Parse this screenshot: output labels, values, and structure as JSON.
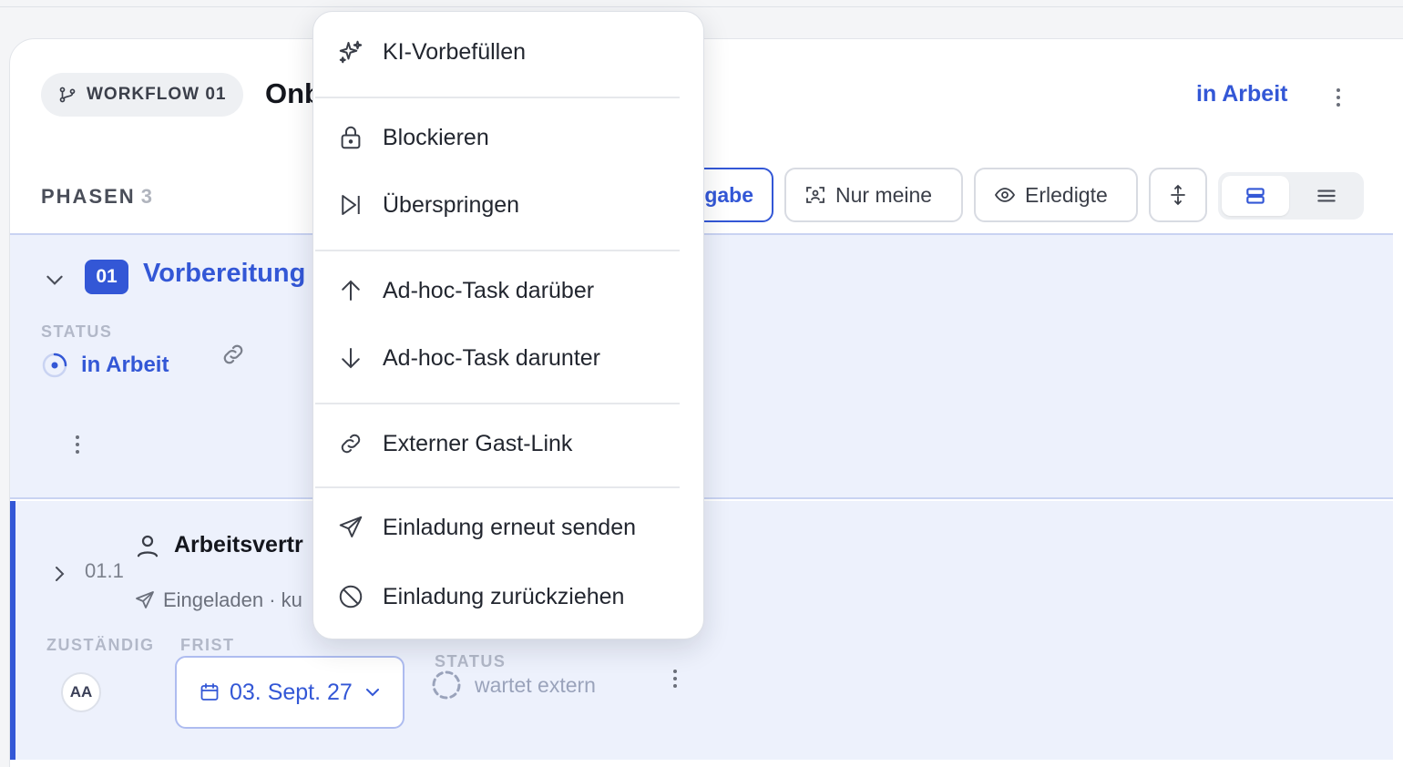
{
  "workflow": {
    "badge_label": "WORKFLOW 01",
    "title": "Onb",
    "status": "in Arbeit"
  },
  "toolbar": {
    "phases_label": "PHASEN",
    "phases_count": "3",
    "eingabe_label": "gabe",
    "nur_meine_label": "Nur meine",
    "erledigte_label": "Erledigte"
  },
  "phase": {
    "number": "01",
    "title": "Vorbereitung",
    "status_label": "STATUS",
    "status_value": "in Arbeit"
  },
  "task": {
    "number": "01.1",
    "title": "Arbeitsvertr",
    "subtitle": "Eingeladen · ku",
    "assignee_label": "ZUSTÄNDIG",
    "deadline_label": "FRIST",
    "status_label": "STATUS",
    "assignee_initials": "AA",
    "deadline_value": "03. Sept. 27",
    "status_value": "wartet extern"
  },
  "menu": {
    "ki_prefill": "KI-Vorbefüllen",
    "block": "Blockieren",
    "skip": "Überspringen",
    "adhoc_above": "Ad-hoc-Task darüber",
    "adhoc_below": "Ad-hoc-Task darunter",
    "guest_link": "Externer Gast-Link",
    "resend_invite": "Einladung erneut senden",
    "withdraw_invite": "Einladung zurückziehen"
  },
  "colors": {
    "accent": "#3357d6",
    "phase_bg": "#edf1fc"
  }
}
